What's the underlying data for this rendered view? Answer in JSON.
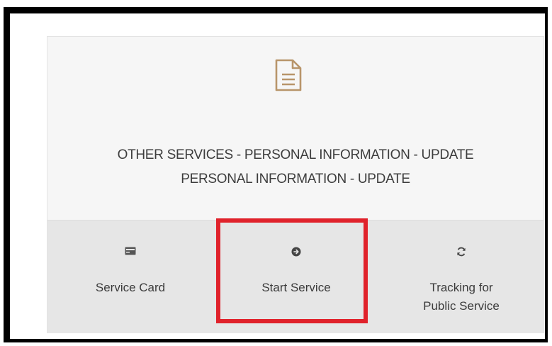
{
  "service": {
    "title_line1": "OTHER SERVICES - PERSONAL INFORMATION - UPDATE",
    "title_line2": "PERSONAL INFORMATION - UPDATE",
    "icon": "document-icon"
  },
  "actions": [
    {
      "label": "Service Card",
      "icon": "card-icon"
    },
    {
      "label": "Start Service",
      "icon": "arrow-circle-right-icon"
    },
    {
      "label_line1": "Tracking for",
      "label_line2": "Public Service",
      "icon": "refresh-icon"
    }
  ],
  "colors": {
    "accent_gold": "#b8956a",
    "highlight_red": "#e0222b",
    "card_top_bg": "#f6f6f6",
    "card_bottom_bg": "#e6e6e6"
  }
}
